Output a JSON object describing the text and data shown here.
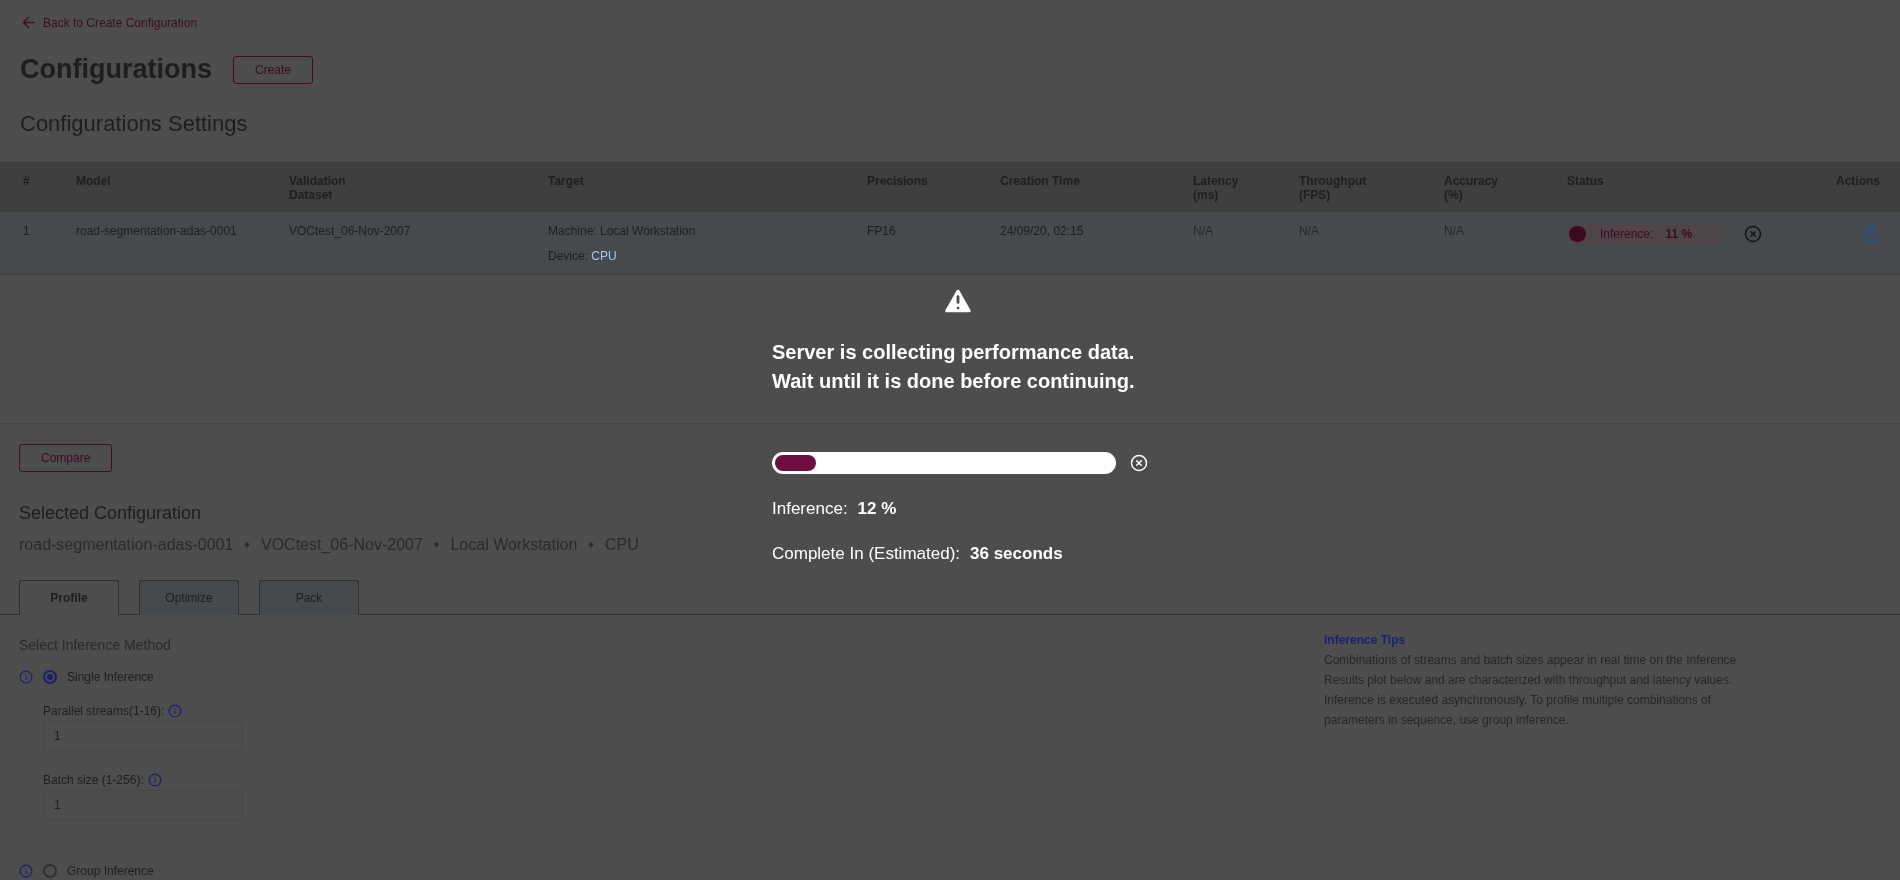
{
  "back_link": {
    "label": "Back to Create Configuration"
  },
  "header": {
    "title": "Configurations",
    "create_button": "Create"
  },
  "section_title": "Configurations Settings",
  "table": {
    "columns": [
      "#",
      "Model",
      "Validation\nDataset",
      "Target",
      "Precisions",
      "Creation Time",
      "Latency\n(ms)",
      "Throughput\n(FPS)",
      "Accuracy\n(%)",
      "Status",
      "Actions"
    ],
    "rows": [
      {
        "number": "1",
        "model": "road-segmentation-adas-0001",
        "dataset": "VOCtest_06-Nov-2007",
        "machine": "Machine: Local Workstation",
        "device_label": "Device:",
        "device": "CPU",
        "precision": "FP16",
        "created": "24/09/20, 02:15",
        "latency": "N/A",
        "throughput": "N/A",
        "accuracy": "N/A",
        "status": {
          "label": "Inference:",
          "value": "11 %",
          "level": 0.11
        }
      }
    ]
  },
  "compare_button": "Compare",
  "selected_configuration": {
    "title": "Selected Configuration",
    "parts": [
      "road-segmentation-adas-0001",
      "•",
      "VOCtest_06-Nov-2007",
      "•",
      "Local Workstation",
      "•",
      "CPU"
    ]
  },
  "tabs": [
    {
      "label": "Profile",
      "selected": true
    },
    {
      "label": "Optimize",
      "selected": false
    },
    {
      "label": "Pack",
      "selected": false
    }
  ],
  "method_title": "Select Inference Method",
  "methods": [
    {
      "label": "Single Inference",
      "selected": true,
      "fields": [
        {
          "label": "Parallel streams(1-16):",
          "value": "1"
        },
        {
          "label": "Batch size (1-256):",
          "value": "1"
        }
      ]
    },
    {
      "label": "Group Inference",
      "selected": false
    }
  ],
  "tips": {
    "title": "Inference Tips",
    "text": "Combinations of streams and batch sizes appear in real time on the Inference Results plot below and are characterized with throughput and latency values. Inference is executed asynchronously. To profile multiple combinations of parameters in sequence, use group inference."
  },
  "overlay": {
    "message_lines": [
      "Server is collecting performance data.",
      "Wait until it is done before continuing."
    ],
    "progress": {
      "level": 0.12
    },
    "inference_label": "Inference:",
    "inference_value": "12 %",
    "eta_label": "Complete In (Estimated):",
    "eta_value": "36 seconds"
  }
}
